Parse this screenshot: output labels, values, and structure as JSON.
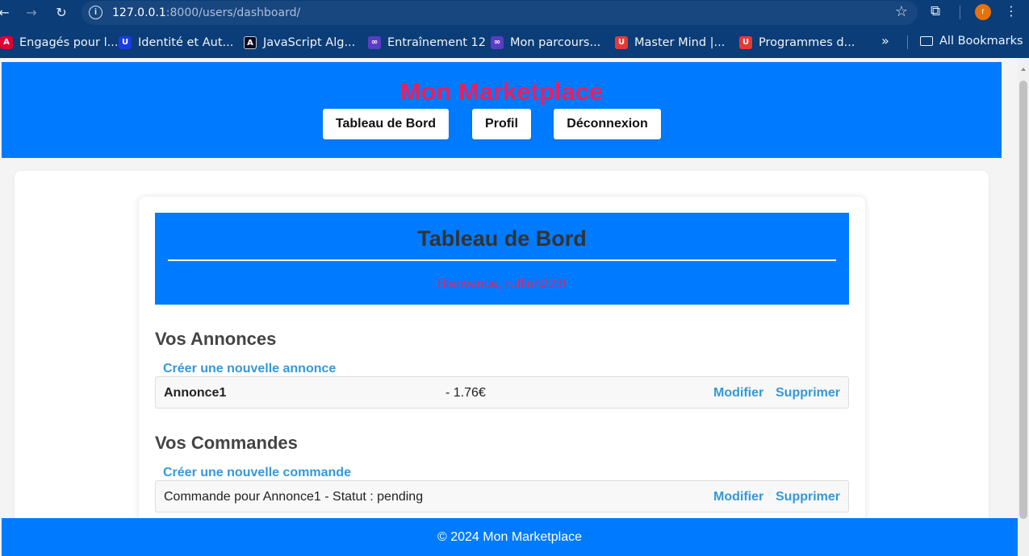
{
  "browser": {
    "url_host": "127.0.0.1",
    "url_rest": ":8000/users/dashboard/",
    "avatar_letter": "r",
    "bookmarks": [
      {
        "label": "Engagés pour l...",
        "icon": "angular-icon",
        "color": "#dd0031"
      },
      {
        "label": "Identité et Aut...",
        "icon": "udacity-icon",
        "color": "#1a3ce6"
      },
      {
        "label": "JavaScript Alg...",
        "icon": "freecodecamp-icon",
        "color": "#0a0a23"
      },
      {
        "label": "Entraînement 12",
        "icon": "course-icon",
        "color": "#5b3cc4"
      },
      {
        "label": "Mon parcours...",
        "icon": "course-icon",
        "color": "#5b3cc4"
      },
      {
        "label": "Master Mind |...",
        "icon": "udemy-icon",
        "color": "#e53935"
      },
      {
        "label": "Programmes d...",
        "icon": "udemy-icon",
        "color": "#e53935"
      }
    ],
    "more_label": "»",
    "all_bookmarks": "All Bookmarks"
  },
  "site": {
    "title": "Mon Marketplace",
    "nav": [
      "Tableau de Bord",
      "Profil",
      "Déconnexion"
    ]
  },
  "dashboard": {
    "title": "Tableau de Bord",
    "welcome": "Bienvenue, ruffinh223!"
  },
  "annonces": {
    "heading": "Vos Annonces",
    "create_link": "Créer une nouvelle annonce",
    "items": [
      {
        "name": "Annonce1",
        "price": "- 1.76€",
        "edit": "Modifier",
        "delete": "Supprimer"
      }
    ]
  },
  "commandes": {
    "heading": "Vos Commandes",
    "create_link": "Créer une nouvelle commande",
    "items": [
      {
        "text": "Commande pour Annonce1 - Statut : pending",
        "edit": "Modifier",
        "delete": "Supprimer"
      }
    ]
  },
  "footer": {
    "text": "© 2024 Mon Marketplace"
  },
  "colors": {
    "header_bg": "#007bff",
    "title_pink": "#e91e63",
    "link_blue": "#3498db",
    "chrome_bg": "#0b3d78"
  }
}
